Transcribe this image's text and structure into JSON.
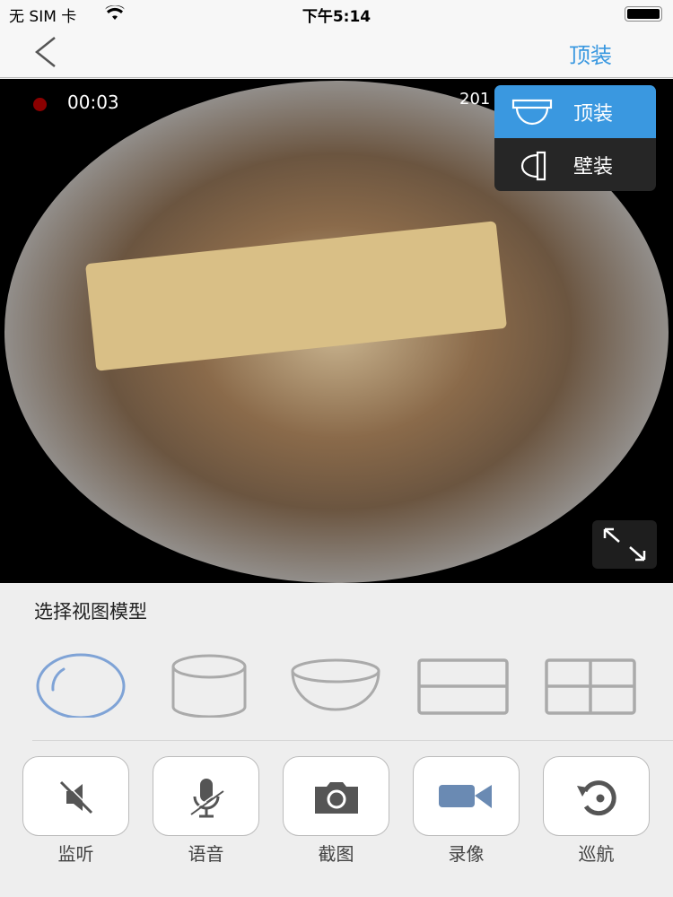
{
  "status_bar": {
    "carrier": "无 SIM 卡",
    "time": "下午5:14",
    "wifi_icon": "wifi-icon",
    "battery_icon": "battery-icon"
  },
  "nav": {
    "back_icon": "chevron-left-icon",
    "right_label": "顶装",
    "accent": "#3a98e0"
  },
  "video": {
    "recording_time": "00:03",
    "timestamp_partial": "201",
    "recording_color": "#8b0000"
  },
  "mount_menu": {
    "items": [
      {
        "label": "顶装",
        "icon": "ceiling-camera-icon",
        "active": true
      },
      {
        "label": "壁装",
        "icon": "wall-camera-icon",
        "active": false
      }
    ]
  },
  "view_model": {
    "title": "选择视图模型",
    "models": [
      {
        "name": "fisheye",
        "selected": true
      },
      {
        "name": "cylinder"
      },
      {
        "name": "bowl"
      },
      {
        "name": "two-split"
      },
      {
        "name": "four-split"
      }
    ],
    "selected_color": "#7fa3d6"
  },
  "actions": [
    {
      "label": "监听",
      "icon": "speaker-muted-icon"
    },
    {
      "label": "语音",
      "icon": "mic-muted-icon"
    },
    {
      "label": "截图",
      "icon": "camera-icon"
    },
    {
      "label": "录像",
      "icon": "video-camera-icon"
    },
    {
      "label": "巡航",
      "icon": "cruise-rotate-icon"
    }
  ]
}
